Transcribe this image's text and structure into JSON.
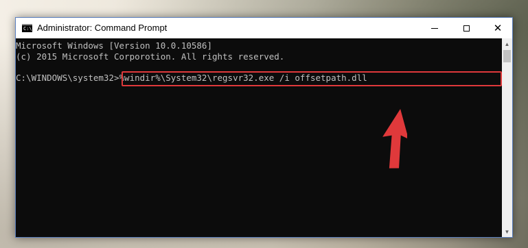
{
  "window": {
    "title": "Administrator: Command Prompt",
    "icon": "cmd-icon",
    "icon_text": "C:\\",
    "controls": {
      "minimize_icon": "minimize-icon",
      "maximize_icon": "maximize-icon",
      "close_icon": "close-icon",
      "close_glyph": "✕"
    }
  },
  "console": {
    "line1": "Microsoft Windows [Version 10.0.10586]",
    "line2": "(c) 2015 Microsoft Corporotion. All rights reserved.",
    "prompt": "C:\\WINDOWS\\system32>",
    "command": "%windir%\\System32\\regsvr32.exe /i offsetpath.dll",
    "background_color": "#0c0c0c",
    "text_color": "#c0c0c0"
  },
  "annotation": {
    "highlight_color": "#e0393b",
    "arrow_color": "#e0393b"
  },
  "scrollbar": {
    "up_glyph": "▲",
    "down_glyph": "▼"
  }
}
